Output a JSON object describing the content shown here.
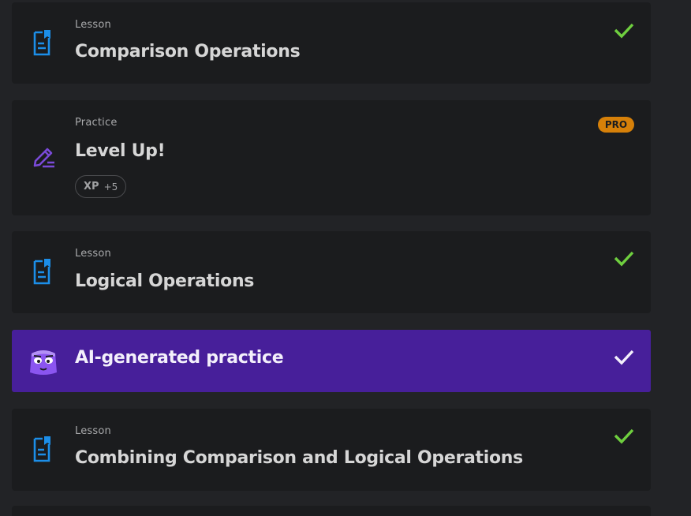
{
  "items": [
    {
      "kind": "Lesson",
      "title": "Comparison Operations",
      "icon": "lesson-document-icon",
      "completed": true
    },
    {
      "kind": "Practice",
      "title": "Level Up!",
      "icon": "practice-pencil-icon",
      "badge": "PRO",
      "xp_label": "XP",
      "xp_value": "+5",
      "completed": false
    },
    {
      "kind": "Lesson",
      "title": "Logical Operations",
      "icon": "lesson-document-icon",
      "completed": true
    },
    {
      "kind": "",
      "title": "AI-generated practice",
      "icon": "ai-mascot-icon",
      "completed": true
    },
    {
      "kind": "Lesson",
      "title": "Combining Comparison and Logical Operations",
      "icon": "lesson-document-icon",
      "completed": true
    }
  ],
  "colors": {
    "lesson_icon": "#1c8ee8",
    "practice_icon": "#7a4ad8",
    "check": "#6fcf3f",
    "pro_badge": "#d68009",
    "ai_card": "#471f9a",
    "card_bg": "#1b1c1e",
    "page_bg": "#222326"
  }
}
